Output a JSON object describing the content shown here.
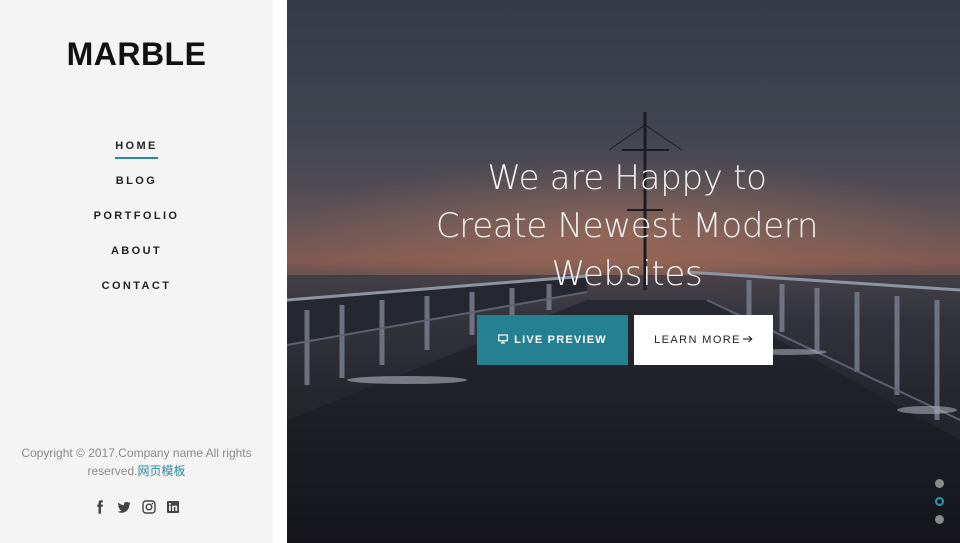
{
  "sidebar": {
    "logo": "MARBLE",
    "nav": [
      {
        "label": "HOME",
        "active": true
      },
      {
        "label": "BLOG",
        "active": false
      },
      {
        "label": "PORTFOLIO",
        "active": false
      },
      {
        "label": "ABOUT",
        "active": false
      },
      {
        "label": "CONTACT",
        "active": false
      }
    ],
    "copyright_line1": "Copyright © 2017.Company name All rights",
    "copyright_line2": "reserved.",
    "copyright_link": "网页模板",
    "socials": [
      "facebook-icon",
      "twitter-icon",
      "instagram-icon",
      "linkedin-icon"
    ]
  },
  "hero": {
    "headline_lines": [
      "We are Happy to",
      "Create Newest Modern",
      "Websites"
    ],
    "preview_button": "LIVE PREVIEW",
    "learn_button": "LEARN MORE",
    "slides": 3,
    "active_slide": 2
  },
  "colors": {
    "accent": "#258092",
    "sidebar_bg": "#f4f4f4",
    "active_underline": "#2a8a9a"
  }
}
